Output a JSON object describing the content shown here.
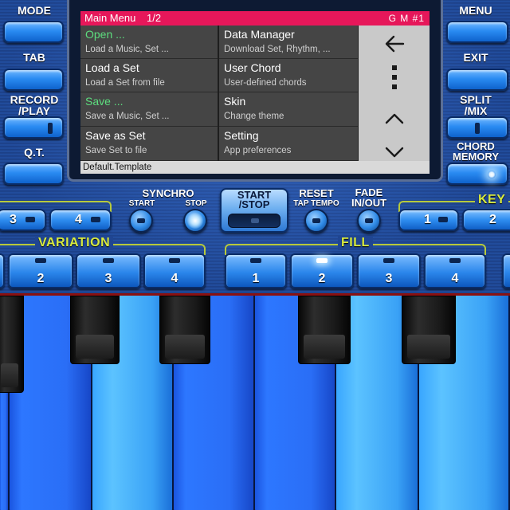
{
  "menu": {
    "title": "Main Menu",
    "page": "1/2",
    "gm": "G M #1",
    "items": [
      {
        "title": "Open ...",
        "subtitle": "Load a Music, Set ...",
        "highlight": true
      },
      {
        "title": "Data Manager",
        "subtitle": "Download Set, Rhythm, ..."
      },
      {
        "title": "Load a Set",
        "subtitle": "Load a Set from file"
      },
      {
        "title": "User Chord",
        "subtitle": "User-defined chords"
      },
      {
        "title": "Save ...",
        "subtitle": "Save a Music, Set ...",
        "highlight": true
      },
      {
        "title": "Skin",
        "subtitle": "Change theme"
      },
      {
        "title": "Save as Set",
        "subtitle": "Save Set to file"
      },
      {
        "title": "Setting",
        "subtitle": "App preferences"
      }
    ],
    "side_icons": [
      "back-arrow-icon",
      "more-vertical-icon",
      "chevron-up-icon",
      "chevron-down-icon"
    ],
    "status": "Default.Template"
  },
  "left_buttons": {
    "mode": "MODE",
    "tab": "TAB",
    "record_play": [
      "RECORD",
      "/PLAY"
    ],
    "qt": "Q.T."
  },
  "right_buttons": {
    "menu": "MENU",
    "exit": "EXIT",
    "split_mix": [
      "SPLIT",
      "/MIX"
    ],
    "chord_memory": [
      "CHORD",
      "MEMORY"
    ]
  },
  "controls": {
    "synchro": "SYNCHRO",
    "synchro_start": "START",
    "synchro_stop": "STOP",
    "start_stop": [
      "START",
      "/STOP"
    ],
    "reset": "RESET",
    "tap_tempo": "TAP TEMPO",
    "fade": [
      "FADE",
      "IN/OUT"
    ],
    "key_section": "KEY"
  },
  "top_pills_left": [
    "3",
    "4"
  ],
  "top_pills_right": [
    "1",
    "2"
  ],
  "variation": {
    "label": "VARIATION",
    "pads": [
      "2",
      "3",
      "4"
    ]
  },
  "fill": {
    "label": "FILL",
    "pads": [
      "1",
      "2",
      "3",
      "4"
    ],
    "active": "2"
  },
  "colors": {
    "title_bar": "#e6175a",
    "highlight_text": "#5dde7f",
    "section_label": "#d8ea3f"
  }
}
